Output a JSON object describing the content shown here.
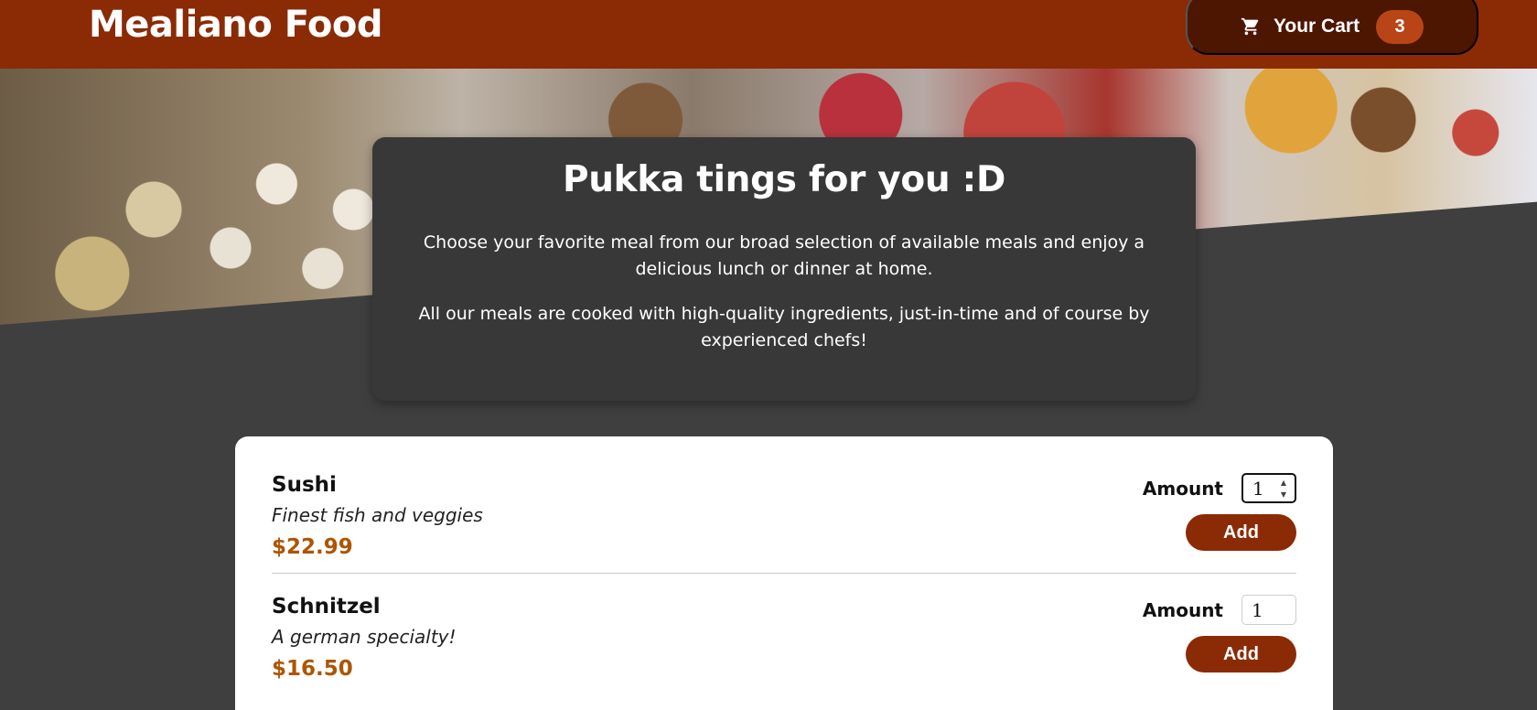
{
  "header": {
    "logo": "Mealiano Food",
    "cart": {
      "label": "Your Cart",
      "count": "3",
      "icon": "cart-icon"
    }
  },
  "summary": {
    "title": "Pukka tings for you :D",
    "paragraph1": "Choose your favorite meal from our broad selection of available meals and enjoy a delicious lunch or dinner at home.",
    "paragraph2": "All our meals are cooked with high-quality ingredients, just-in-time and of course by experienced chefs!"
  },
  "meals": [
    {
      "name": "Sushi",
      "description": "Finest fish and veggies",
      "price": "$22.99",
      "amount_label": "Amount",
      "amount": "1",
      "add_label": "Add"
    },
    {
      "name": "Schnitzel",
      "description": "A german specialty!",
      "price": "$16.50",
      "amount_label": "Amount",
      "amount": "1",
      "add_label": "Add"
    }
  ],
  "colors": {
    "header": "#8a2b06",
    "cart_button": "#4d1601",
    "badge": "#b94517",
    "price": "#ad5502",
    "background": "#3f3f3f"
  }
}
